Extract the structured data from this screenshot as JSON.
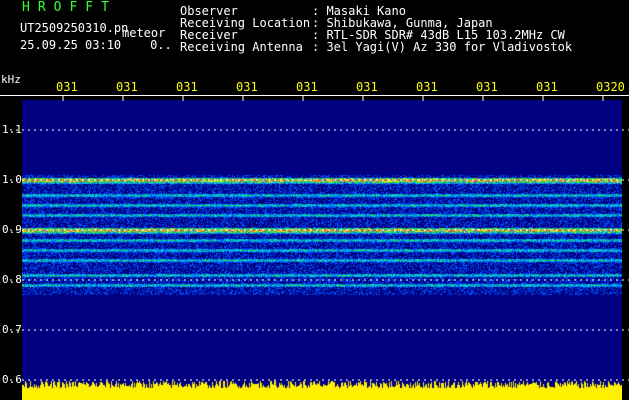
{
  "header_left": {
    "title": "HROFFT",
    "filename": "UT2509250310.pn",
    "meteor_label": "meteor",
    "datetime": "25.09.25 03:10",
    "count": "0.."
  },
  "header_right": [
    {
      "key": "Observer",
      "value": ": Masaki Kano"
    },
    {
      "key": "Receiving Location",
      "value": ": Shibukawa, Gunma, Japan"
    },
    {
      "key": "Receiver",
      "value": ": RTL-SDR SDR# 43dB L15 103.2MHz CW"
    },
    {
      "key": "Receiving Antenna",
      "value": ": 3el Yagi(V) Az 330 for Vladivostok"
    }
  ],
  "chart_data": {
    "type": "heatmap",
    "ylabel": "kHz",
    "yticks": [
      "1.1",
      "1.0",
      "0.9",
      "0.8",
      "0.7",
      "0.6"
    ],
    "ylim": [
      0.6,
      1.15
    ],
    "xticks": [
      "031",
      "031",
      "031",
      "031",
      "031",
      "031",
      "031",
      "031",
      "031",
      "0320"
    ],
    "signal_band_khz": [
      0.77,
      1.01
    ],
    "strong_lines_khz": [
      1.0,
      0.9
    ],
    "colors": {
      "background": "#000080",
      "noise_strong": "#ffff00",
      "line_peak": "#ff3030",
      "noise_low": "#0050ff",
      "grid": "#ffffff"
    }
  }
}
